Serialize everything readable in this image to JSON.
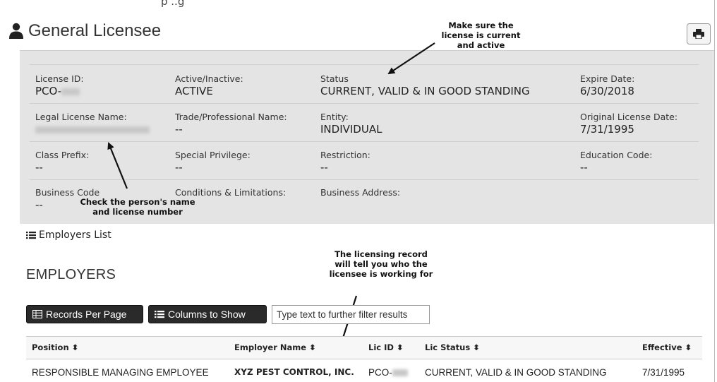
{
  "top_caption": "p        ..g",
  "header": {
    "title": "General Licensee",
    "print_icon": "printer-icon",
    "user_icon": "user-icon"
  },
  "license": {
    "rows": [
      [
        {
          "label": "License ID:",
          "value": "PCO-"
        },
        {
          "label": "Active/Inactive:",
          "value": "ACTIVE"
        },
        {
          "label": "Status",
          "value": "CURRENT, VALID & IN GOOD STANDING"
        },
        {
          "label": "Expire Date:",
          "value": "6/30/2018"
        }
      ],
      [
        {
          "label": "Legal License Name:",
          "value": ""
        },
        {
          "label": "Trade/Professional Name:",
          "value": "--"
        },
        {
          "label": "Entity:",
          "value": "INDIVIDUAL"
        },
        {
          "label": "Original License Date:",
          "value": "7/31/1995"
        }
      ],
      [
        {
          "label": "Class Prefix:",
          "value": "--"
        },
        {
          "label": "Special Privilege:",
          "value": "--"
        },
        {
          "label": "Restriction:",
          "value": "--"
        },
        {
          "label": "Education Code:",
          "value": "--"
        }
      ],
      [
        {
          "label": "Business Code",
          "value": "--"
        },
        {
          "label": "Conditions & Limitations:",
          "value": ""
        },
        {
          "label": "Business Address:",
          "value": ""
        }
      ]
    ]
  },
  "annotations": {
    "current": "Make sure the\nlicense is current\nand active",
    "name": "Check the person's name\nand license number",
    "employer": "The licensing record\nwill tell you who the\nlicensee is working for"
  },
  "employers": {
    "list_link": "Employers List",
    "heading": "EMPLOYERS",
    "records_btn": "Records Per Page",
    "columns_btn": "Columns to Show",
    "filter_placeholder": "Type text to further filter results",
    "columns": [
      "Position ⬍",
      "Employer Name ⬍",
      "Lic ID ⬍",
      "Lic Status ⬍",
      "Effective ⬍"
    ],
    "rows": [
      [
        "RESPONSIBLE MANAGING EMPLOYEE",
        "XYZ PEST CONTROL, INC.",
        "PCO-",
        "CURRENT, VALID & IN GOOD STANDING",
        "7/31/1995"
      ]
    ]
  }
}
